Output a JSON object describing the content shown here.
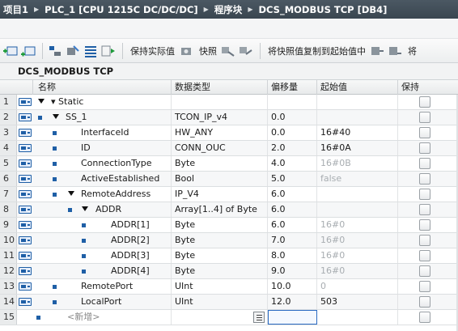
{
  "breadcrumb": {
    "items": [
      "项目1",
      "PLC_1 [CPU 1215C DC/DC/DC]",
      "程序块",
      "DCS_MODBUS TCP [DB4]"
    ]
  },
  "toolbar": {
    "keep_actual_label": "保持实际值",
    "snapshot_label": "快照",
    "copy_snapshot_label": "将快照值复制到起始值中",
    "trailing_label": "将"
  },
  "block": {
    "title": "DCS_MODBUS TCP"
  },
  "table": {
    "columns": {
      "name": "名称",
      "datatype": "数据类型",
      "offset": "偏移量",
      "start": "起始值",
      "retain": "保持"
    },
    "rows": [
      {
        "num": "1",
        "name": "▾ Static",
        "type": "",
        "offset": "",
        "start": ""
      },
      {
        "num": "2",
        "name": "SS_1",
        "type": "TCON_IP_v4",
        "offset": "0.0",
        "start": ""
      },
      {
        "num": "3",
        "name": "InterfaceId",
        "type": "HW_ANY",
        "offset": "0.0",
        "start": "16#40"
      },
      {
        "num": "4",
        "name": "ID",
        "type": "CONN_OUC",
        "offset": "2.0",
        "start": "16#0A"
      },
      {
        "num": "5",
        "name": "ConnectionType",
        "type": "Byte",
        "offset": "4.0",
        "start": "16#0B"
      },
      {
        "num": "6",
        "name": "ActiveEstablished",
        "type": "Bool",
        "offset": "5.0",
        "start": "false"
      },
      {
        "num": "7",
        "name": "RemoteAddress",
        "type": "IP_V4",
        "offset": "6.0",
        "start": ""
      },
      {
        "num": "8",
        "name": "ADDR",
        "type": "Array[1..4] of Byte",
        "offset": "6.0",
        "start": ""
      },
      {
        "num": "9",
        "name": "ADDR[1]",
        "type": "Byte",
        "offset": "6.0",
        "start": "16#0"
      },
      {
        "num": "10",
        "name": "ADDR[2]",
        "type": "Byte",
        "offset": "7.0",
        "start": "16#0"
      },
      {
        "num": "11",
        "name": "ADDR[3]",
        "type": "Byte",
        "offset": "8.0",
        "start": "16#0"
      },
      {
        "num": "12",
        "name": "ADDR[4]",
        "type": "Byte",
        "offset": "9.0",
        "start": "16#0"
      },
      {
        "num": "13",
        "name": "RemotePort",
        "type": "UInt",
        "offset": "10.0",
        "start": "0"
      },
      {
        "num": "14",
        "name": "LocalPort",
        "type": "UInt",
        "offset": "12.0",
        "start": "503"
      },
      {
        "num": "15",
        "name": "<新增>",
        "type": "",
        "offset": "",
        "start": ""
      }
    ]
  },
  "colors": {
    "accent": "#1f5fa6",
    "breadcrumb_bg": "#3f4b55"
  }
}
